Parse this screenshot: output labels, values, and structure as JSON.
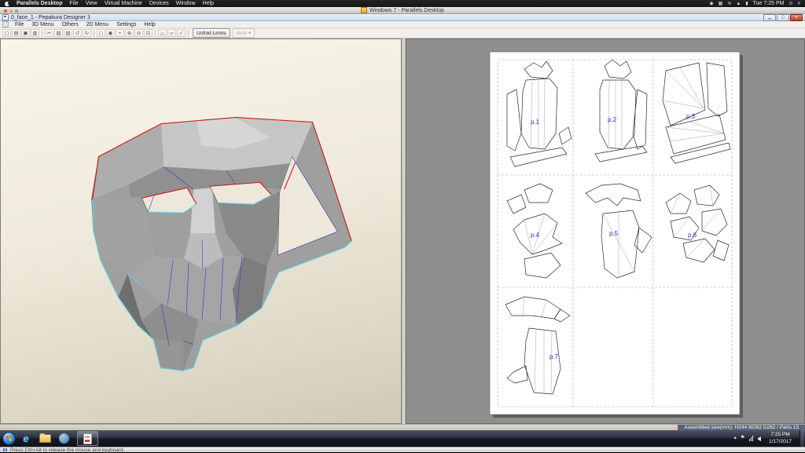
{
  "colors": {
    "accent_blue": "#2233cc",
    "edge_red": "#d41717",
    "edge_cyan": "#5fd4e4",
    "fold_blue": "#3a3acc",
    "taskbar_dark": "#14171f",
    "pane_cream": "#efeadb"
  },
  "mac_menubar": {
    "app_name": "Parallels Desktop",
    "items": [
      "File",
      "View",
      "Virtual Machine",
      "Devices",
      "Window",
      "Help"
    ],
    "clock": "Tue 7:25 PM"
  },
  "parallels_window": {
    "title": "Windows 7 - Parallels Desktop"
  },
  "pepakura": {
    "title": "0_face_1 - Pepakura Designer 3",
    "menu": [
      "File",
      "3D Menu",
      "Others",
      "2D Menu",
      "Settings",
      "Help"
    ],
    "toolbar": {
      "unfold_limits_label": "Unfold Limits",
      "auto_label": "Auto",
      "auto_caret": "▾"
    },
    "toolbar_icons": [
      {
        "name": "new-file",
        "glyph": "▢"
      },
      {
        "name": "open-file",
        "glyph": "▤"
      },
      {
        "name": "save-file",
        "glyph": "▣"
      },
      {
        "name": "print",
        "glyph": "▥"
      },
      {
        "name": "cut",
        "glyph": "✂"
      },
      {
        "name": "copy",
        "glyph": "▧"
      },
      {
        "name": "paste",
        "glyph": "▨"
      },
      {
        "name": "undo",
        "glyph": "↺"
      },
      {
        "name": "redo",
        "glyph": "↻"
      },
      {
        "name": "select",
        "glyph": "◻"
      },
      {
        "name": "rotate-view",
        "glyph": "◉"
      },
      {
        "name": "pan-view",
        "glyph": "+"
      },
      {
        "name": "zoom-in",
        "glyph": "⊕"
      },
      {
        "name": "zoom-out",
        "glyph": "⊖"
      },
      {
        "name": "fit-view",
        "glyph": "⊡"
      },
      {
        "name": "show-edges",
        "glyph": "△"
      },
      {
        "name": "show-flaps",
        "glyph": "▱"
      },
      {
        "name": "check-layout",
        "glyph": "✓"
      }
    ],
    "patterns": [
      "p.1",
      "p.2",
      "p.3",
      "p.4",
      "p.5",
      "p.6",
      "p.7"
    ],
    "statusbar_text": "Assembled size(mm): H244 W282 D262 / Parts 15"
  },
  "win_taskbar": {
    "time": "7:25 PM",
    "date": "1/17/2017",
    "hidden_icons_glyph": "▴",
    "action_center_glyph": "⚑"
  },
  "mac_statusbar": {
    "message": "Press Ctrl+Alt to release the mouse and keyboard."
  }
}
